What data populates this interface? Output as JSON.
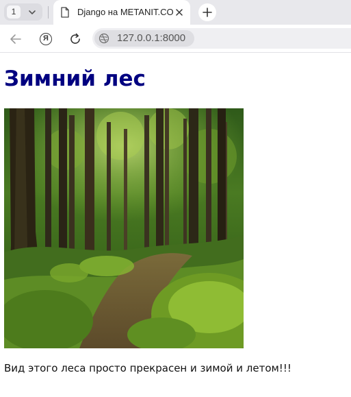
{
  "browser": {
    "tab_counter": "1",
    "tab_title": "Django на METANIT.COM",
    "address": "127.0.0.1:8000"
  },
  "page": {
    "heading": "Зимний лес",
    "image_alt": "forest-photo",
    "text": "Вид этого леса просто прекрасен и зимой и летом!!!"
  },
  "colors": {
    "heading": "#000080",
    "tabstrip": "#e8e8ec",
    "address_bar": "#efeff2"
  }
}
